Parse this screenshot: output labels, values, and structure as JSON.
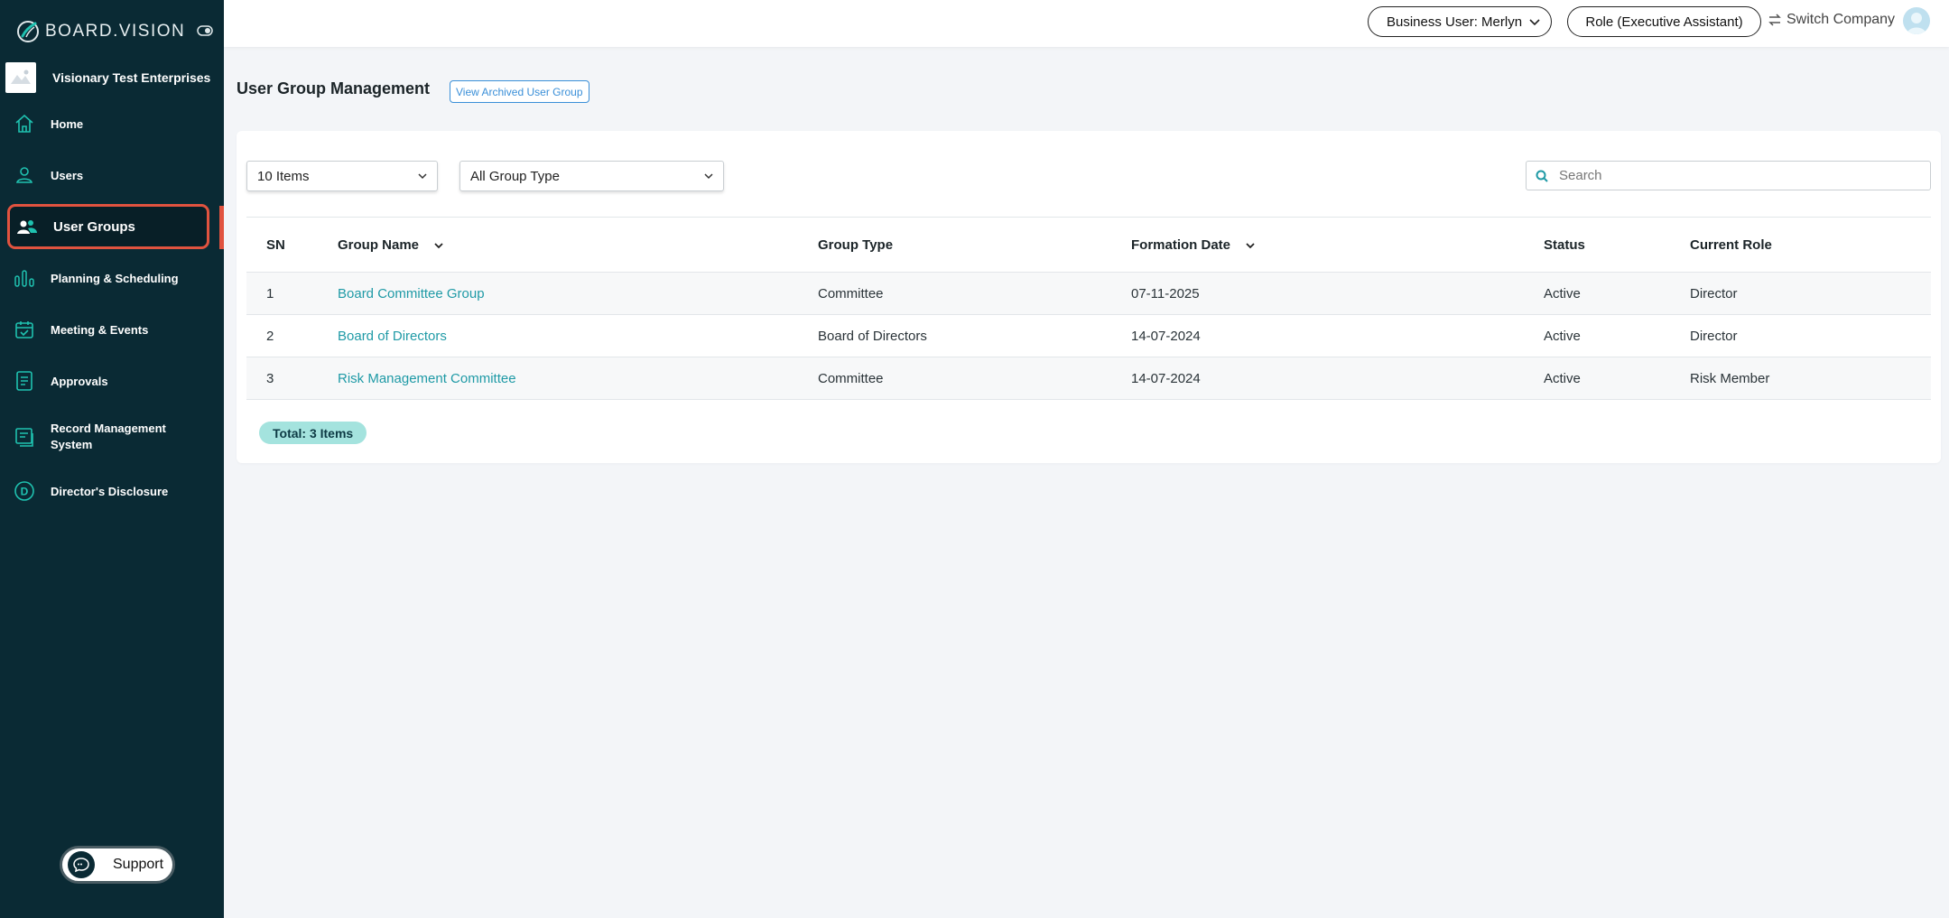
{
  "brand": {
    "name": "BOARD.VISION"
  },
  "company": {
    "name": "Visionary Test Enterprises"
  },
  "sidebar": {
    "items": [
      {
        "label": "Home",
        "icon": "home-icon"
      },
      {
        "label": "Users",
        "icon": "user-icon"
      },
      {
        "label": "User Groups",
        "icon": "user-group-icon",
        "active": true
      },
      {
        "label": "Planning & Scheduling",
        "icon": "bar-chart-icon"
      },
      {
        "label": "Meeting & Events",
        "icon": "calendar-check-icon"
      },
      {
        "label": "Approvals",
        "icon": "document-icon"
      },
      {
        "label": "Record Management System",
        "icon": "record-icon"
      },
      {
        "label": "Director's Disclosure",
        "icon": "circle-d-icon"
      }
    ],
    "support_label": "Support"
  },
  "topbar": {
    "business_user": "Business User: Merlyn",
    "role": "Role (Executive Assistant)",
    "switch_company": "Switch Company"
  },
  "page": {
    "title": "User Group Management",
    "archived_button": "View Archived User Group"
  },
  "filters": {
    "items_per_page": "10 Items",
    "group_type": "All Group Type",
    "search_placeholder": "Search"
  },
  "table": {
    "headers": [
      "SN",
      "Group Name",
      "Group Type",
      "Formation Date",
      "Status",
      "Current Role"
    ],
    "rows": [
      [
        "1",
        "Board Committee Group",
        "Committee",
        "07-11-2025",
        "Active",
        "Director"
      ],
      [
        "2",
        "Board of Directors",
        "Board of Directors",
        "14-07-2024",
        "Active",
        "Director"
      ],
      [
        "3",
        "Risk Management Committee",
        "Committee",
        "14-07-2024",
        "Active",
        "Risk Member"
      ]
    ]
  },
  "total": "Total: 3 Items",
  "colors": {
    "sidebar_bg": "#0a2a34",
    "accent_teal": "#1f9aa6",
    "active_outline": "#e1533f",
    "link_blue": "#3a8fd8",
    "total_badge": "#a4e3de"
  }
}
